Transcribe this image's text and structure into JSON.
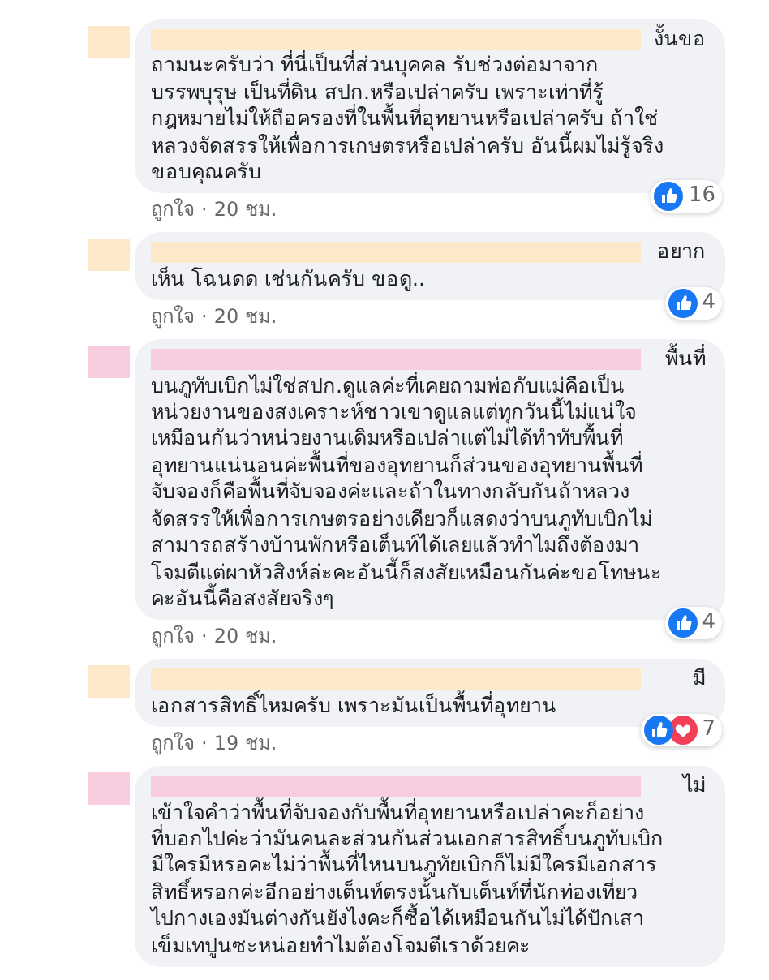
{
  "separator": "·",
  "comments": [
    {
      "color": "#fde9c9",
      "lead": "งั้นขอ",
      "text": "ถามนะครับว่า ที่นี่เป็นที่ส่วนบุคคล รับช่วงต่อมาจาก\nบรรพบุรุษ เป็นที่ดิน สปก.หรือเปล่าครับ เพราะเท่าที่รู้\nกฎหมายไม่ให้ถือครองที่ในพื้นที่อุทยานหรือเปล่าครับ ถ้าใช่\nหลวงจัดสรรให้เพื่อการเกษตรหรือเปล่าครับ อันนี้ผมไม่รู้จริง\nขอบคุณครับ",
      "like": "ถูกใจ",
      "time": "20 ชม.",
      "reactions": [
        {
          "kind": "like"
        }
      ],
      "count": "16"
    },
    {
      "color": "#fde9c9",
      "lead": "อยาก",
      "text": "เห็น โฉนดด เช่นกันครับ ขอดู..",
      "like": "ถูกใจ",
      "time": "20 ชม.",
      "reactions": [
        {
          "kind": "like"
        }
      ],
      "count": "4"
    },
    {
      "color": "#f9cde0",
      "lead": "พื้นที่",
      "text": "บนภูทับเบิกไม่ใช่สปก.ดูแลค่ะที่เคยถามพ่อกับแม่คือเป็น\nหน่วยงานของสงเคราะห์ชาวเขาดูแลแต่ทุกวันนี้ไม่แน่ใจ\nเหมือนกันว่าหน่วยงานเดิมหรือเปล่าแต่ไม่ได้ทำทับพื้นที่\nอุทยานแน่นอนค่ะพื้นที่ของอุทยานก็ส่วนของอุทยานพื้นที่\nจับจองก็คือพื้นที่จับจองค่ะและถ้าในทางกลับกันถ้าหลวง\nจัดสรรให้เพื่อการเกษตรอย่างเดียวก็แสดงว่าบนภูทับเบิกไม่\nสามารถสร้างบ้านพักหรือเต็นท์ได้เลยแล้วทำไมถึงต้องมา\nโจมตีแต่ผาหัวสิงห์ล่ะคะอันนี้ก็สงสัยเหมือนกันค่ะขอโทษนะ\nคะอันนี้คือสงสัยจริงๆ",
      "like": "ถูกใจ",
      "time": "20 ชม.",
      "reactions": [
        {
          "kind": "like"
        }
      ],
      "count": "4"
    },
    {
      "color": "#fde9c9",
      "lead": "มี",
      "text": "เอกสารสิทธิ์ไหมครับ เพราะมันเป็นพื้นที่อุทยาน",
      "like": "ถูกใจ",
      "time": "19 ชม.",
      "reactions": [
        {
          "kind": "like"
        },
        {
          "kind": "love"
        }
      ],
      "count": "7"
    },
    {
      "color": "#f9cde0",
      "lead": "ไม่",
      "text": "เข้าใจคำว่าพื้นที่จับจองกับพื้นที่อุทยานหรือเปล่าคะก็อย่าง\nที่บอกไปค่ะว่ามันคนละส่วนกันส่วนเอกสารสิทธิ์บนภูทับเบิก\nมีใครมีหรอคะไม่ว่าพื้นที่ไหนบนภูทัยเบิกก็ไม่มีใครมีเอกสาร\nสิทธิ์หรอกค่ะอีกอย่างเต็นท์ตรงนั้นกับเต็นท์ที่นักท่องเที่ยว\nไปกางเองมันต่างกันยังไงคะก็ซื้อได้เหมือนกันไม่ได้ปักเสา\nเข็มเทปูนซะหน่อยทำไมต้องโจมตีเราด้วยคะ"
    }
  ]
}
